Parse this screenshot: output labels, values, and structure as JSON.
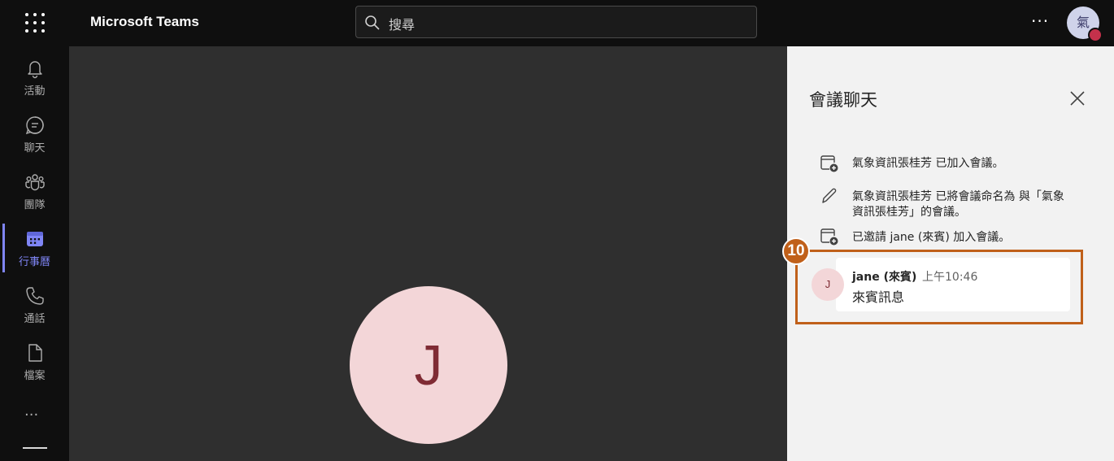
{
  "app": {
    "title": "Microsoft Teams"
  },
  "search": {
    "placeholder": "搜尋"
  },
  "header": {
    "more_label": "···",
    "user_avatar_text": "氣",
    "presence_color": "#c4314b"
  },
  "rail": {
    "items": [
      {
        "label": "活動",
        "icon": "bell-icon"
      },
      {
        "label": "聊天",
        "icon": "chat-icon"
      },
      {
        "label": "團隊",
        "icon": "teams-icon"
      },
      {
        "label": "行事曆",
        "icon": "calendar-icon",
        "active": true
      },
      {
        "label": "通話",
        "icon": "phone-icon"
      },
      {
        "label": "檔案",
        "icon": "file-icon"
      }
    ],
    "more_label": "···",
    "accent_color": "#7f85f5"
  },
  "stage": {
    "participant_initial": "J",
    "avatar_color": "#f3d6d8"
  },
  "chat_panel": {
    "title": "會議聊天",
    "events": [
      {
        "icon": "calendar-add-icon",
        "text": "氣象資訊張桂芳 已加入會議。"
      },
      {
        "icon": "pencil-icon",
        "text_line1": "氣象資訊張桂芳 已將會議命名為 與「氣象",
        "text_line2": "資訊張桂芳」的會議。"
      },
      {
        "icon": "calendar-add-icon",
        "text": "已邀請 jane (來賓) 加入會議。"
      }
    ],
    "message": {
      "avatar_initial": "J",
      "sender": "jane (來賓)",
      "time": "上午10:46",
      "body": "來賓訊息"
    }
  },
  "annotation": {
    "step_number": "10",
    "color": "#c0601a"
  }
}
